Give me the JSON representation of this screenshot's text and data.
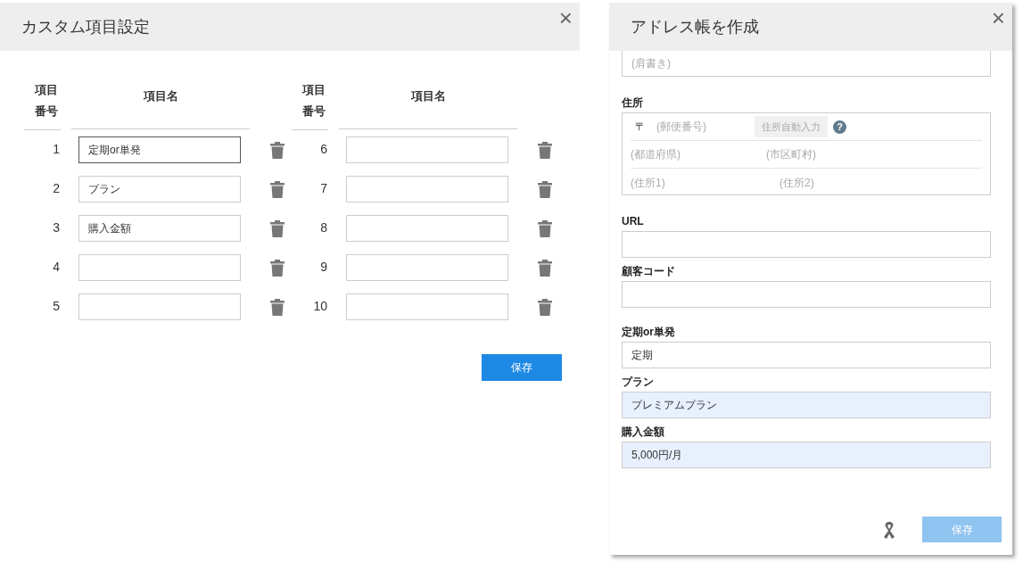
{
  "custom_fields_dialog": {
    "title": "カスタム項目設定",
    "close_icon": "×",
    "groups": [
      {
        "number_heading": "項目番号",
        "name_heading": "項目名",
        "items": [
          {
            "number": "1",
            "value": "定期or単発",
            "focused": true
          },
          {
            "number": "2",
            "value": "プラン",
            "focused": false
          },
          {
            "number": "3",
            "value": "購入金額",
            "focused": false
          },
          {
            "number": "4",
            "focused": false
          },
          {
            "number": "5",
            "focused": false
          }
        ]
      },
      {
        "number_heading": "項目番号",
        "name_heading": "項目名",
        "items": [
          {
            "number": "6",
            "focused": false
          },
          {
            "number": "7",
            "focused": false
          },
          {
            "number": "8",
            "focused": false
          },
          {
            "number": "9",
            "focused": false
          },
          {
            "number": "10",
            "focused": false
          }
        ]
      }
    ],
    "save_button": {
      "label": "保存",
      "disabled": false
    }
  },
  "address_book_dialog": {
    "title": "アドレス帳を作成",
    "close_icon": "×",
    "fields": [
      {
        "kind": "partial",
        "placeholder": "(肩書き)"
      },
      {
        "kind": "address",
        "label": "住所",
        "postal_mark": "〒",
        "postal_placeholder": "(郵便番号)",
        "autofill_button": "住所自動入力",
        "help_icon": "?",
        "prefecture_placeholder": "(都道府県)",
        "city_placeholder": "(市区町村)",
        "address1_placeholder": "(住所1)",
        "address2_placeholder": "(住所2)"
      },
      {
        "kind": "text",
        "label": "URL",
        "autofilled": false
      },
      {
        "kind": "text",
        "label": "顧客コード",
        "autofilled": false
      },
      {
        "kind": "custom",
        "label": "定期or単発",
        "value": "定期",
        "autofilled": false
      },
      {
        "kind": "custom",
        "label": "プラン",
        "value": "プレミアムプラン",
        "autofilled": true
      },
      {
        "kind": "custom",
        "label": "購入金額",
        "value": "5,000円/月",
        "autofilled": true
      }
    ],
    "save_button": {
      "label": "保存",
      "disabled": true
    }
  }
}
